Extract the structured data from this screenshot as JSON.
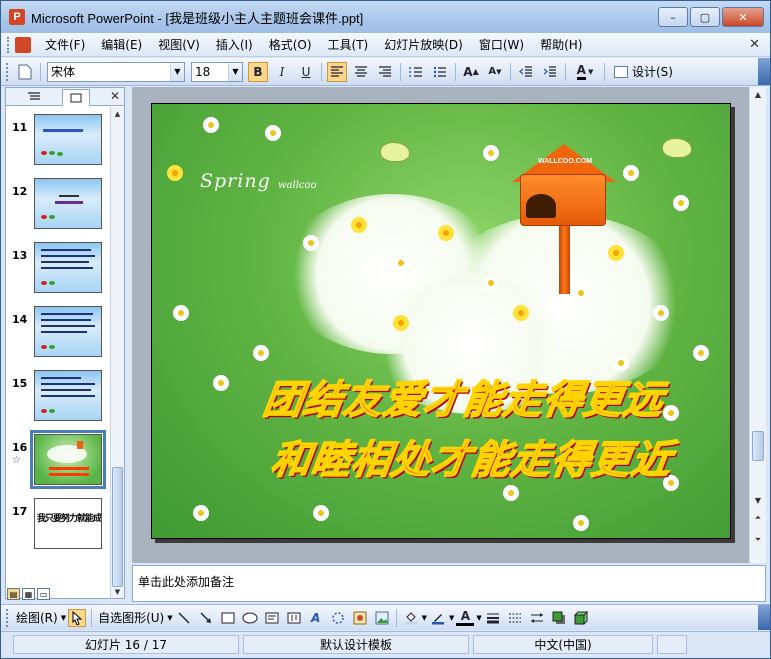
{
  "window": {
    "title": "Microsoft PowerPoint - [我是班级小主人主题班会课件.ppt]",
    "controls": [
      "–",
      "▢",
      "✕"
    ]
  },
  "menu": {
    "items": [
      "文件(F)",
      "编辑(E)",
      "视图(V)",
      "插入(I)",
      "格式(O)",
      "工具(T)",
      "幻灯片放映(D)",
      "窗口(W)",
      "帮助(H)"
    ],
    "close_glyph": "✕"
  },
  "format_toolbar": {
    "font_name": "宋体",
    "font_size": "18",
    "bold": "B",
    "italic": "I",
    "underline": "U",
    "font_color_glyph": "A",
    "design_label": "设计(S)"
  },
  "slide_panel": {
    "close_glyph": "✕",
    "selected_slide": 16,
    "thumbnails": [
      {
        "number": "11",
        "style": "blue-title"
      },
      {
        "number": "12",
        "style": "blue-center"
      },
      {
        "number": "13",
        "style": "blue-text"
      },
      {
        "number": "14",
        "style": "blue-text"
      },
      {
        "number": "15",
        "style": "blue-text"
      },
      {
        "number": "16",
        "style": "green",
        "star": "☆"
      },
      {
        "number": "17",
        "style": "white-text",
        "text": "我只要努力就能成为班级的小主人!"
      }
    ]
  },
  "slide": {
    "watermark_main": "Spring",
    "watermark_sub": "wallcoo",
    "mailbox_tag": "WALLCOO.COM",
    "line1": "团结友爱才能走得更远",
    "line2": "和睦相处才能走得更近"
  },
  "notes": {
    "placeholder": "单击此处添加备注"
  },
  "draw_toolbar": {
    "draw_label": "绘图(R)",
    "autoshapes_label": "自选图形(U)"
  },
  "status": {
    "slide_info": "幻灯片 16 / 17",
    "template": "默认设计模板",
    "language": "中文(中国)"
  }
}
